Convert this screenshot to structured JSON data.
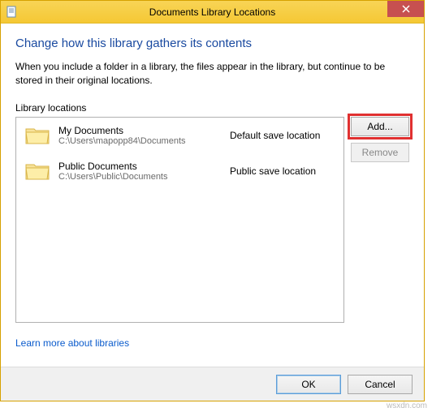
{
  "titlebar": {
    "title": "Documents Library Locations"
  },
  "heading": "Change how this library gathers its contents",
  "description": "When you include a folder in a library, the files appear in the library, but continue to be stored in their original locations.",
  "section_label": "Library locations",
  "locations": [
    {
      "name": "My Documents",
      "path": "C:\\Users\\mapopp84\\Documents",
      "status": "Default save location"
    },
    {
      "name": "Public Documents",
      "path": "C:\\Users\\Public\\Documents",
      "status": "Public save location"
    }
  ],
  "buttons": {
    "add": "Add...",
    "remove": "Remove",
    "ok": "OK",
    "cancel": "Cancel"
  },
  "learn_link": "Learn more about libraries",
  "watermark": "wsxdn.com"
}
